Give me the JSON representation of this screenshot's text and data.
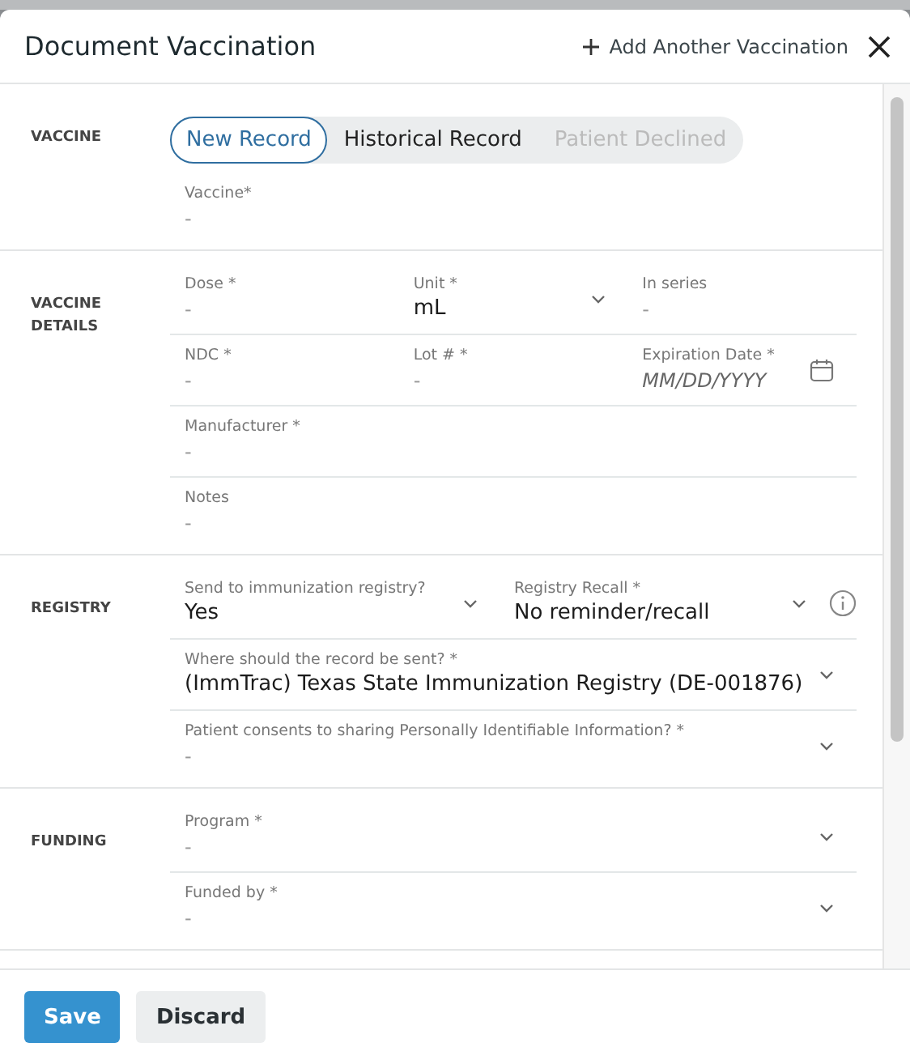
{
  "dialog": {
    "title": "Document Vaccination",
    "add_action": "Add Another Vaccination"
  },
  "sections": [
    {
      "label": "VACCINE",
      "segments": [
        {
          "label": "New Record",
          "selected": true,
          "disabled": false
        },
        {
          "label": "Historical Record",
          "selected": false,
          "disabled": false
        },
        {
          "label": "Patient Declined",
          "selected": false,
          "disabled": true
        }
      ],
      "rows": [
        {
          "fields": [
            {
              "kind": "text",
              "label": "Vaccine*",
              "placeholder": "-"
            }
          ]
        }
      ]
    },
    {
      "label": "VACCINE DETAILS",
      "rows": [
        {
          "fields": [
            {
              "kind": "text",
              "label": "Dose *",
              "placeholder": "-"
            },
            {
              "kind": "select",
              "label": "Unit *",
              "value": "mL"
            },
            {
              "kind": "text",
              "label": "In series",
              "placeholder": "-"
            }
          ]
        },
        {
          "fields": [
            {
              "kind": "text",
              "label": "NDC *",
              "placeholder": "-"
            },
            {
              "kind": "text",
              "label": "Lot # *",
              "placeholder": "-"
            },
            {
              "kind": "date",
              "label": "Expiration Date *",
              "placeholder": "MM/DD/YYYY"
            }
          ]
        },
        {
          "fields": [
            {
              "kind": "text",
              "label": "Manufacturer *",
              "placeholder": "-"
            }
          ]
        },
        {
          "fields": [
            {
              "kind": "text",
              "label": "Notes",
              "placeholder": "-"
            }
          ]
        }
      ]
    },
    {
      "label": "REGISTRY",
      "rows": [
        {
          "info": true,
          "fields": [
            {
              "kind": "select",
              "label": "Send to immunization registry?",
              "value": "Yes"
            },
            {
              "kind": "select",
              "label": "Registry Recall *",
              "value": "No reminder/recall"
            }
          ]
        },
        {
          "fields": [
            {
              "kind": "select",
              "label": "Where should the record be sent? *",
              "value": "(ImmTrac) Texas State Immunization Registry (DE-001876)"
            }
          ]
        },
        {
          "fields": [
            {
              "kind": "select",
              "label": "Patient consents to sharing Personally Identifiable Information? *",
              "placeholder": "-"
            }
          ]
        }
      ]
    },
    {
      "label": "FUNDING",
      "rows": [
        {
          "fields": [
            {
              "kind": "select",
              "label": "Program *",
              "placeholder": "-"
            }
          ]
        },
        {
          "fields": [
            {
              "kind": "select",
              "label": "Funded by *",
              "placeholder": "-"
            }
          ]
        }
      ]
    }
  ],
  "buttons": [
    {
      "label": "Save",
      "kind": "primary"
    },
    {
      "label": "Discard",
      "kind": "secondary"
    }
  ]
}
